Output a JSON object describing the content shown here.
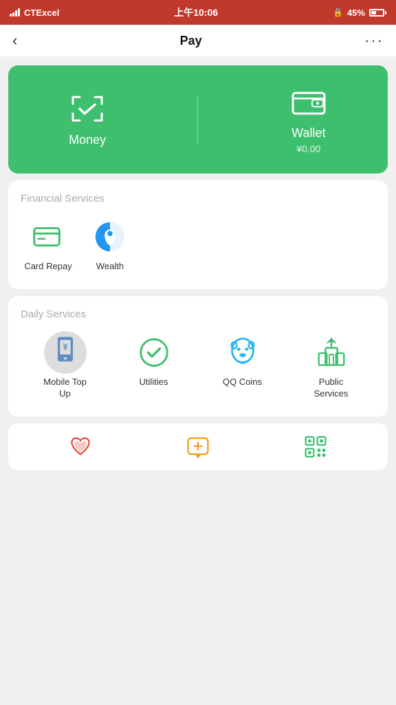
{
  "statusBar": {
    "carrier": "CTExcel",
    "time": "上午10:06",
    "battery": "45%"
  },
  "navBar": {
    "title": "Pay",
    "back": "‹",
    "more": "···"
  },
  "greenCard": {
    "money": {
      "label": "Money"
    },
    "wallet": {
      "label": "Wallet",
      "sublabel": "¥0.00"
    }
  },
  "financialServices": {
    "sectionTitle": "Financial Services",
    "items": [
      {
        "label": "Card Repay",
        "iconType": "card-repay"
      },
      {
        "label": "Wealth",
        "iconType": "wealth"
      }
    ]
  },
  "dailyServices": {
    "sectionTitle": "Daily Services",
    "items": [
      {
        "label": "Mobile Top\nUp",
        "iconType": "mobile-topup"
      },
      {
        "label": "Utilities",
        "iconType": "utilities"
      },
      {
        "label": "QQ Coins",
        "iconType": "qq-coins"
      },
      {
        "label": "Public\nServices",
        "iconType": "public-services"
      }
    ]
  },
  "bottomToolbar": {
    "items": [
      {
        "label": "",
        "iconType": "health"
      },
      {
        "label": "",
        "iconType": "add-chat"
      },
      {
        "label": "",
        "iconType": "qr-grid"
      }
    ]
  }
}
